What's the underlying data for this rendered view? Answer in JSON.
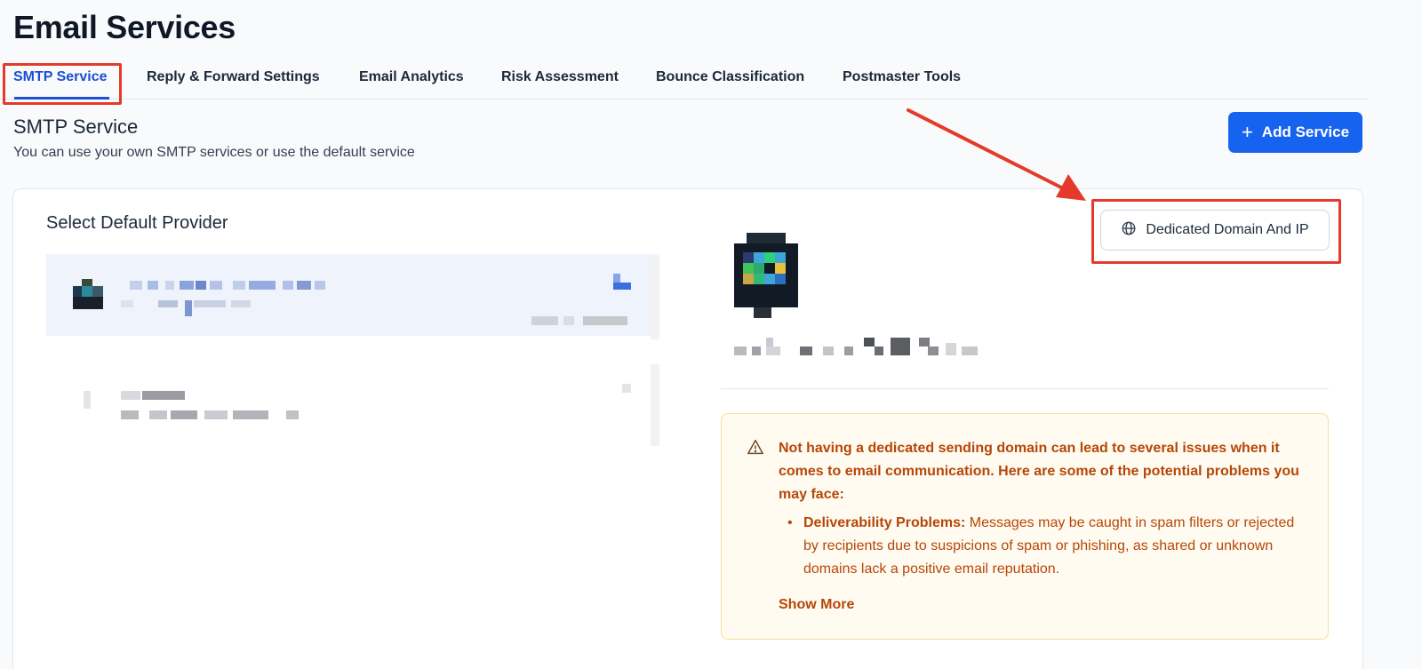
{
  "page": {
    "title": "Email Services"
  },
  "tabs": [
    {
      "label": "SMTP Service",
      "active": true
    },
    {
      "label": "Reply & Forward Settings"
    },
    {
      "label": "Email Analytics"
    },
    {
      "label": "Risk Assessment"
    },
    {
      "label": "Bounce Classification"
    },
    {
      "label": "Postmaster Tools"
    }
  ],
  "section": {
    "title": "SMTP Service",
    "subtitle": "You can use your own SMTP services or use the default service",
    "add_button": "Add Service",
    "add_icon": "plus-icon"
  },
  "provider": {
    "heading": "Select Default Provider"
  },
  "details": {
    "dedicated_button": "Dedicated Domain And IP",
    "dedicated_icon": "globe-icon"
  },
  "warning": {
    "icon": "warning-triangle-icon",
    "message": "Not having a dedicated sending domain can lead to several issues when it comes to email communication. Here are some of the potential problems you may face:",
    "bullets": [
      {
        "title": "Deliverability Problems:",
        "text": " Messages may be caught in spam filters or rejected by recipients due to suspicions of spam or phishing, as shared or unknown domains lack a positive email reputation."
      }
    ],
    "show_more": "Show More"
  },
  "colors": {
    "accent": "#1663f0",
    "tab_active": "#1d4ed8",
    "annotation": "#e53a2b",
    "warning_text": "#b54708",
    "warning_bg": "#fffbf0"
  }
}
